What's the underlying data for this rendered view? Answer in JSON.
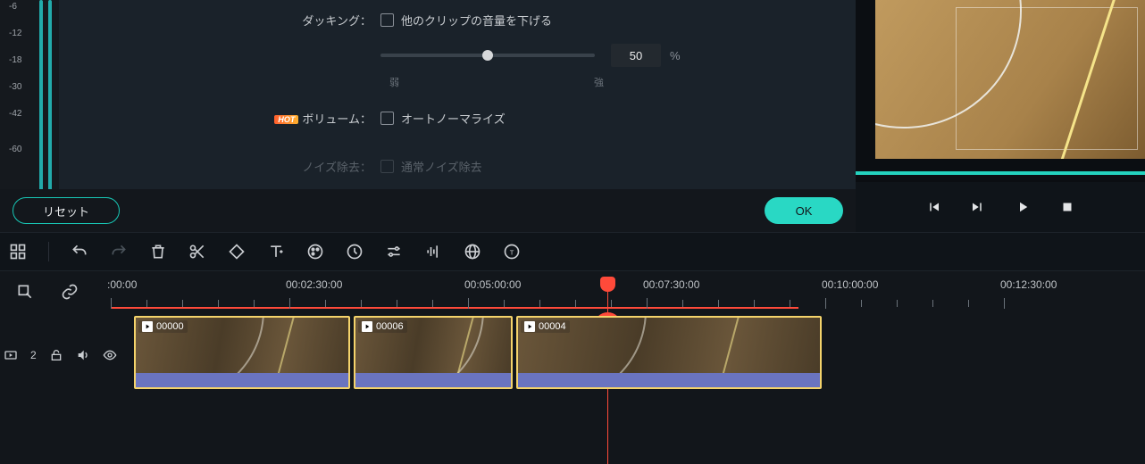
{
  "panel": {
    "ducking_label": "ダッキング：",
    "ducking_checkbox": "他のクリップの音量を下げる",
    "ducking_value": "50",
    "ducking_unit": "%",
    "weak": "弱",
    "strong": "強",
    "hot": "HOT",
    "volume_label": "ボリューム：",
    "autonormalize": "オートノーマライズ",
    "noise_label": "ノイズ除去：",
    "noise_checkbox": "通常ノイズ除去",
    "reset": "リセット",
    "ok": "OK"
  },
  "db_ticks": [
    "-6",
    "-12",
    "-18",
    "-30",
    "-42",
    "-60"
  ],
  "ruler": {
    "labels": [
      ":00:00",
      "00:02:30:00",
      "00:05:00:00",
      "00:07:30:00",
      "00:10:00:00",
      "00:12:30:00"
    ]
  },
  "track": {
    "num": "2"
  },
  "clips": [
    {
      "name": "00000"
    },
    {
      "name": "00006"
    },
    {
      "name": "00004"
    }
  ],
  "chart_data": {
    "type": "line",
    "title": "Audio dB meter ticks",
    "categories": [
      "-6",
      "-12",
      "-18",
      "-30",
      "-42",
      "-60"
    ],
    "values": [
      -6,
      -12,
      -18,
      -30,
      -42,
      -60
    ],
    "ylim": [
      -60,
      0
    ]
  }
}
